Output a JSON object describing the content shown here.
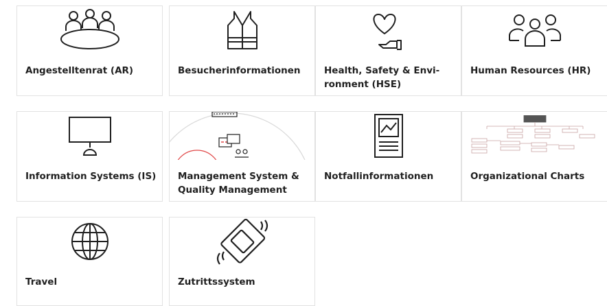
{
  "tiles": [
    {
      "label": "Angestelltenrat (AR)",
      "icon": "meeting-table-icon"
    },
    {
      "label": "Besucherinformationen",
      "icon": "safety-vest-icon"
    },
    {
      "label": "Health, Safety & Envi-\nronment (HSE)",
      "icon": "heart-hand-icon"
    },
    {
      "label": "Human Resources (HR)",
      "icon": "people-group-icon"
    },
    {
      "label": "Information Systems (IS)",
      "icon": "monitor-icon"
    },
    {
      "label": "Management System &\nQuality Management",
      "icon": "management-system-image"
    },
    {
      "label": "Notfallinformationen",
      "icon": "document-chart-icon"
    },
    {
      "label": "Organizational Charts",
      "icon": "org-chart-image"
    },
    {
      "label": "Travel",
      "icon": "globe-icon"
    },
    {
      "label": "Zutrittssystem",
      "icon": "access-card-icon"
    }
  ]
}
